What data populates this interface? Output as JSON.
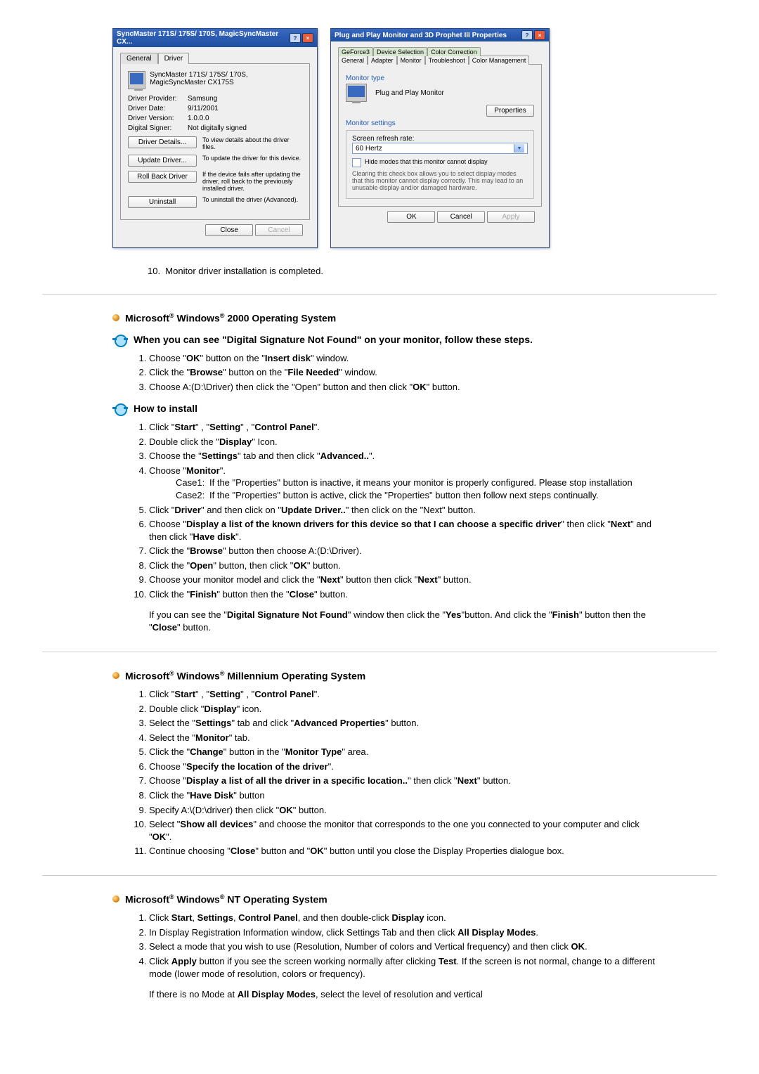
{
  "dialog_left": {
    "title": "SyncMaster 171S/ 175S/ 170S, MagicSyncMaster CX...",
    "tab_general": "General",
    "tab_driver": "Driver",
    "header": "SyncMaster 171S/ 175S/ 170S, MagicSyncMaster CX175S",
    "rows": {
      "provider_lbl": "Driver Provider:",
      "provider_val": "Samsung",
      "date_lbl": "Driver Date:",
      "date_val": "9/11/2001",
      "version_lbl": "Driver Version:",
      "version_val": "1.0.0.0",
      "signer_lbl": "Digital Signer:",
      "signer_val": "Not digitally signed"
    },
    "btns": {
      "details": "Driver Details...",
      "details_txt": "To view details about the driver files.",
      "update": "Update Driver...",
      "update_txt": "To update the driver for this device.",
      "rollback": "Roll Back Driver",
      "rollback_txt": "If the device fails after updating the driver, roll back to the previously installed driver.",
      "uninstall": "Uninstall",
      "uninstall_txt": "To uninstall the driver (Advanced)."
    },
    "close": "Close",
    "cancel": "Cancel"
  },
  "dialog_right": {
    "title": "Plug and Play Monitor and 3D Prophet III Properties",
    "tabs_top": {
      "geforce": "GeForce3",
      "devsel": "Device Selection",
      "colorcorr": "Color Correction"
    },
    "tabs_bottom": {
      "general": "General",
      "adapter": "Adapter",
      "monitor": "Monitor",
      "troubleshoot": "Troubleshoot",
      "colormgmt": "Color Management"
    },
    "mon_type_lbl": "Monitor type",
    "mon_name": "Plug and Play Monitor",
    "properties_btn": "Properties",
    "mon_settings_lbl": "Monitor settings",
    "refresh_lbl": "Screen refresh rate:",
    "refresh_val": "60 Hertz",
    "hide_modes": "Hide modes that this monitor cannot display",
    "hide_note": "Clearing this check box allows you to select display modes that this monitor cannot display correctly. This may lead to an unusable display and/or damaged hardware.",
    "ok": "OK",
    "cancel": "Cancel",
    "apply": "Apply"
  },
  "step10": "Monitor driver installation is completed.",
  "sec_2000": {
    "title_pre": "Microsoft",
    "title_mid": " Windows",
    "title_post": " 2000 Operating System",
    "sub1": "When you can see \"Digital Signature Not Found\" on your monitor, follow these steps.",
    "li1": "Choose \"OK\" button on the \"Insert disk\" window.",
    "li2": "Click the \"Browse\" button on the \"File Needed\" window.",
    "li3": "Choose A:(D:\\Driver) then click the \"Open\" button and then click \"OK\" button.",
    "sub2": "How to install",
    "h1": "Click \"Start\" , \"Setting\" , \"Control Panel\".",
    "h2": "Double click the \"Display\" Icon.",
    "h3": "Choose the \"Settings\" tab and then click \"Advanced..\".",
    "h4": "Choose \"Monitor\".",
    "case1_lbl": "Case1:",
    "case1_txt": "If the \"Properties\" button is inactive, it means your monitor is properly configured. Please stop installation",
    "case2_lbl": "Case2:",
    "case2_txt": "If the \"Properties\" button is active, click the \"Properties\" button then follow next steps continually.",
    "h5": "Click \"Driver\" and then click on \"Update Driver..\" then click on the \"Next\" button.",
    "h6": "Choose \"Display a list of the known drivers for this device so that I can choose a specific driver\" then click \"Next\" and then click \"Have disk\".",
    "h7": "Click the \"Browse\" button then choose A:(D:\\Driver).",
    "h8": "Click the \"Open\" button, then click \"OK\" button.",
    "h9": "Choose your monitor model and click the \"Next\" button then click \"Next\" button.",
    "h10": "Click the \"Finish\" button then the \"Close\" button.",
    "after": "If you can see the \"Digital Signature Not Found\" window then click the \"Yes\"button. And click the \"Finish\" button then the \"Close\" button."
  },
  "sec_me": {
    "title": " Millennium Operating System",
    "m1": "Click \"Start\" , \"Setting\" , \"Control Panel\".",
    "m2": "Double click \"Display\" icon.",
    "m3": "Select the \"Settings\" tab and click \"Advanced Properties\" button.",
    "m4": "Select the \"Monitor\" tab.",
    "m5": "Click the \"Change\" button in the \"Monitor Type\" area.",
    "m6": "Choose \"Specify the location of the driver\".",
    "m7": "Choose \"Display a list of all the driver in a specific location..\" then click \"Next\" button.",
    "m8": "Click the \"Have Disk\" button",
    "m9": "Specify A:\\(D:\\driver) then click \"OK\" button.",
    "m10": "Select \"Show all devices\" and choose the monitor that corresponds to the one you connected to your computer and click \"OK\".",
    "m11": "Continue choosing \"Close\" button and \"OK\" button until you close the Display Properties dialogue box."
  },
  "sec_nt": {
    "title": " NT Operating System",
    "n1": "Click Start, Settings, Control Panel, and then double-click Display icon.",
    "n2": "In Display Registration Information window, click Settings Tab and then click All Display Modes.",
    "n3": "Select a mode that you wish to use (Resolution, Number of colors and Vertical frequency) and then click OK.",
    "n4": "Click Apply button if you see the screen working normally after clicking Test. If the screen is not normal, change to a different mode (lower mode of resolution, colors or frequency).",
    "note": "If there is no Mode at All Display Modes, select the level of resolution and vertical"
  }
}
